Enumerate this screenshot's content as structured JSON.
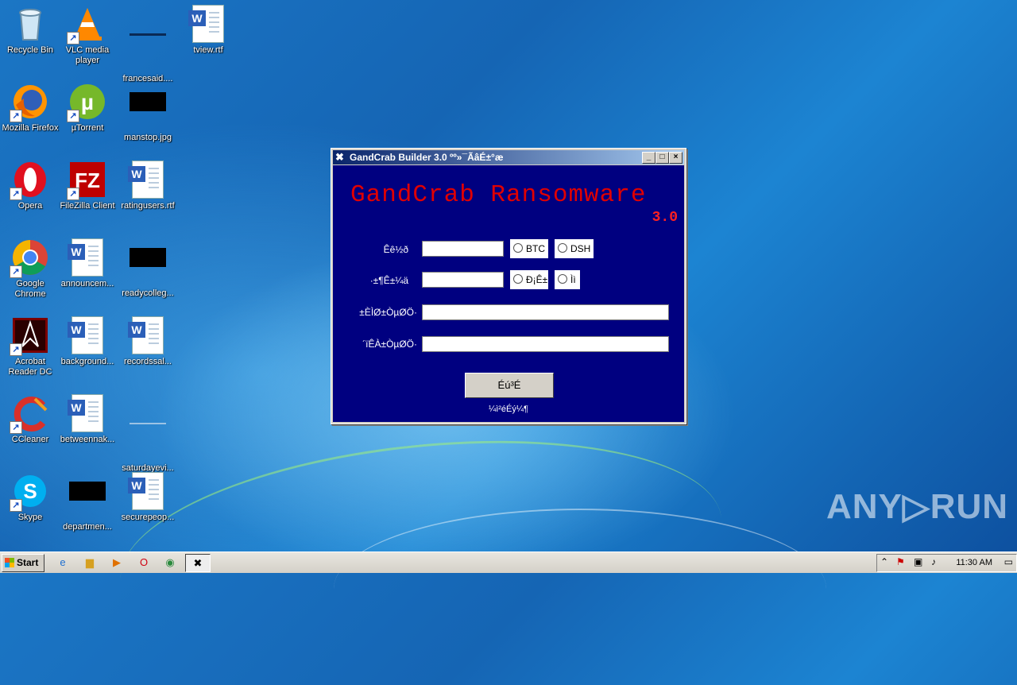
{
  "desktop": {
    "icons": [
      {
        "label": "Recycle Bin"
      },
      {
        "label": "VLC media player"
      },
      {
        "label": "francesaid...."
      },
      {
        "label": "tview.rtf"
      },
      {
        "label": "Mozilla Firefox"
      },
      {
        "label": "µTorrent"
      },
      {
        "label": "manstop.jpg"
      },
      {
        "label": "Opera"
      },
      {
        "label": "FileZilla Client"
      },
      {
        "label": "ratingusers.rtf"
      },
      {
        "label": "Google Chrome"
      },
      {
        "label": "announcem..."
      },
      {
        "label": "readycolleg..."
      },
      {
        "label": "Acrobat Reader DC"
      },
      {
        "label": "background..."
      },
      {
        "label": "recordssal..."
      },
      {
        "label": "CCleaner"
      },
      {
        "label": "betweennak..."
      },
      {
        "label": "saturdayevi..."
      },
      {
        "label": "Skype"
      },
      {
        "label": "departmen..."
      },
      {
        "label": "securepeop..."
      }
    ]
  },
  "window": {
    "title": "GandCrab Builder 3.0 ºº»¯ÃâÉ±°æ",
    "heading": "GandCrab Ransomware",
    "version": "3.0",
    "fields": {
      "label1": "Êê½ð",
      "label2": "·­±¶Ê±¼ä",
      "label3": "±ÈÌØ±ÒµØÖ·",
      "label4": "´ïÊÀ±ÒµØÖ·"
    },
    "radios": {
      "btc": "BTC",
      "dsh": "DSH",
      "r3": "Ð¡Ê±",
      "r4": "Ìì"
    },
    "button": "Éú³É",
    "note": "¼ì²éÉý¼¶"
  },
  "taskbar": {
    "start_label": "Start",
    "clock": "11:30 AM"
  },
  "watermark": "ANY▷RUN"
}
